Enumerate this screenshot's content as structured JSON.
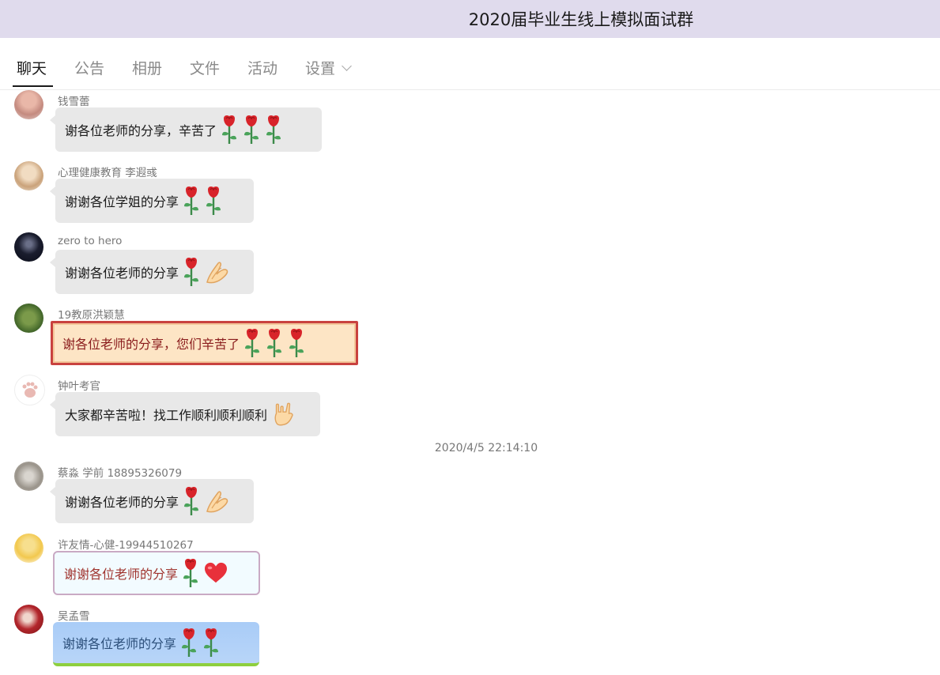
{
  "window": {
    "title": "2020届毕业生线上模拟面试群"
  },
  "tabs": [
    {
      "label": "聊天",
      "active": true
    },
    {
      "label": "公告",
      "active": false
    },
    {
      "label": "相册",
      "active": false
    },
    {
      "label": "文件",
      "active": false
    },
    {
      "label": "活动",
      "active": false
    },
    {
      "label": "设置",
      "active": false
    }
  ],
  "messages": [
    {
      "sender": "钱雪蕾",
      "text": "谢各位老师的分享，辛苦了",
      "emojis": [
        "rose-icon",
        "rose-icon",
        "rose-icon"
      ]
    },
    {
      "sender": "心理健康教育 李遐彧",
      "text": "谢谢各位学姐的分享",
      "emojis": [
        "rose-icon",
        "rose-icon"
      ]
    },
    {
      "sender": "zero to hero",
      "text": "谢谢各位老师的分享",
      "emojis": [
        "rose-icon",
        "praying-hands-icon"
      ]
    },
    {
      "sender": "19教原洪颖慧",
      "text": "谢各位老师的分享，您们辛苦了",
      "emojis": [
        "rose-icon",
        "rose-icon",
        "rose-icon"
      ]
    },
    {
      "sender": "钟叶考官",
      "text": "大家都辛苦啦！找工作顺利顺利顺利",
      "emojis": [
        "rock-hand-icon"
      ]
    },
    {
      "sender": "蔡淼 学前 18895326079",
      "text": "谢谢各位老师的分享",
      "emojis": [
        "rose-icon",
        "praying-hands-icon"
      ]
    },
    {
      "sender": "许友情-心健-19944510267",
      "text": "谢谢各位老师的分享",
      "emojis": [
        "rose-icon",
        "heart-icon"
      ]
    },
    {
      "sender": "吴孟雪",
      "text": "谢谢各位老师的分享",
      "emojis": [
        "rose-icon",
        "rose-icon"
      ]
    }
  ],
  "timestamp": "2020/4/5 22:14:10",
  "colors": {
    "titlebar": "#e0dbed",
    "bubble": "#e8e8e8"
  }
}
